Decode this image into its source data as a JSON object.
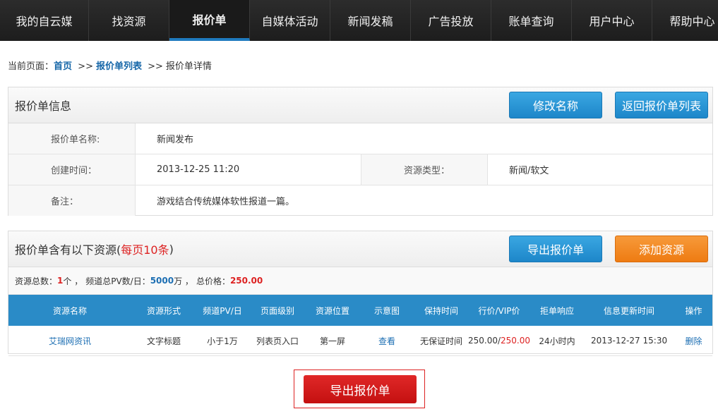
{
  "nav": {
    "items": [
      "我的自云媒",
      "找资源",
      "报价单",
      "自媒体活动",
      "新闻发稿",
      "广告投放",
      "账单查询",
      "用户中心",
      "帮助中心"
    ]
  },
  "breadcrumb": {
    "prefix": "当前页面：",
    "home": "首页",
    "sep": ">>",
    "list": "报价单列表",
    "current": "报价单详情"
  },
  "info_panel": {
    "title": "报价单信息",
    "rename_button": "修改名称",
    "back_button": "返回报价单列表",
    "name_label": "报价单名称:",
    "name_value": "新闻发布",
    "created_label": "创建时间：",
    "created_value": "2013-12-25 11:20",
    "type_label": "资源类型：",
    "type_value": "新闻/软文",
    "remark_label": "备注：",
    "remark_value": "游戏结合传统媒体软性报道一篇。"
  },
  "resource_panel": {
    "title": "报价单含有以下资源(",
    "title_red": "每页10条",
    "title_end": ")",
    "export_button": "导出报价单",
    "add_button": "添加资源"
  },
  "summary": {
    "total_label": "资源总数：",
    "total_value": "1",
    "total_unit": "个 ，",
    "pv_label": "频道总PV数/日：",
    "pv_value": "5000",
    "pv_unit": "万 ，",
    "price_label": "总价格：",
    "price_value": "250.00"
  },
  "table": {
    "headers": [
      "资源名称",
      "资源形式",
      "频道PV/日",
      "页面级别",
      "资源位置",
      "示意图",
      "保持时间",
      "行价/VIP价",
      "拒单响应",
      "信息更新时间",
      "操作"
    ],
    "rows": [
      {
        "name": "艾瑞网资讯",
        "form": "文字标题",
        "pv": "小于1万",
        "level": "列表页入口",
        "position": "第一屏",
        "preview": "查看",
        "keep": "无保证时间",
        "price": "250.00/",
        "vip_price": "250.00",
        "response": "24小时内",
        "updated": "2013-12-27 15:30",
        "action": "删除"
      }
    ]
  },
  "bottom": {
    "export_button": "导出报价单"
  }
}
